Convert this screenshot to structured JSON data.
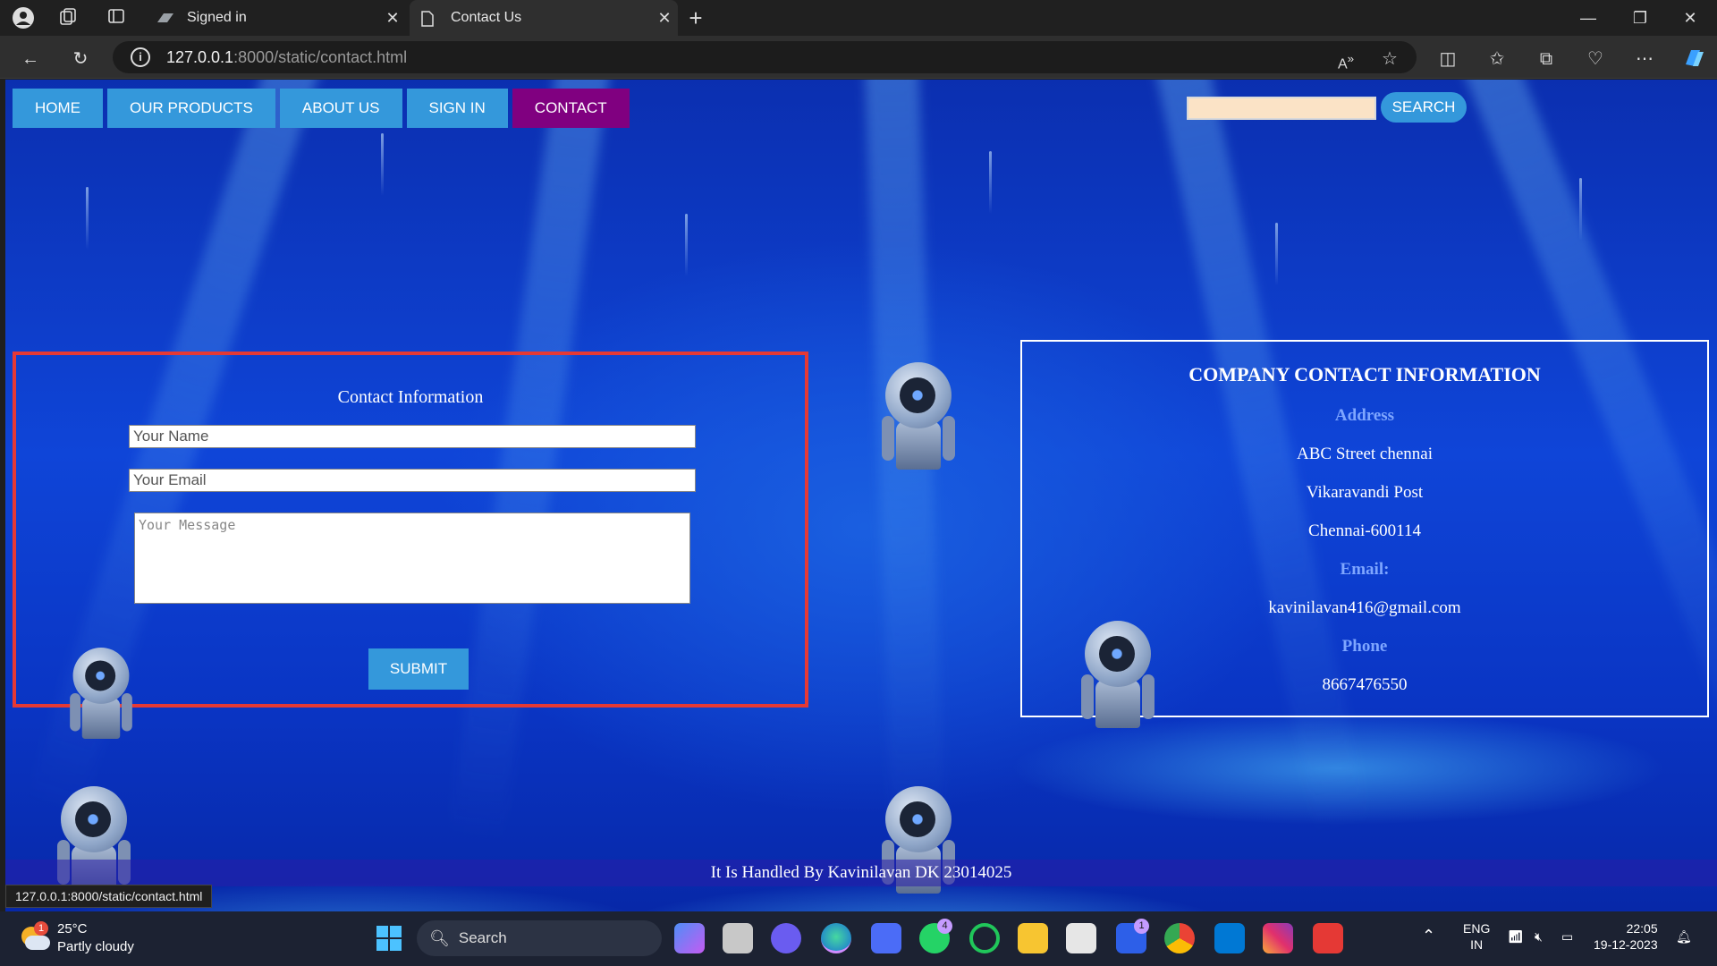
{
  "browser": {
    "tabs": [
      {
        "title": "Signed in",
        "active": false
      },
      {
        "title": "Contact Us",
        "active": true
      }
    ],
    "url_host": "127.0.0.1",
    "url_rest": ":8000/static/contact.html",
    "status_url": "127.0.0.1:8000/static/contact.html"
  },
  "nav": {
    "items": [
      "HOME",
      "OUR PRODUCTS",
      "ABOUT US",
      "SIGN IN",
      "CONTACT"
    ],
    "active": "CONTACT",
    "search_placeholder": "",
    "search_button": "SEARCH"
  },
  "contact_form": {
    "title": "Contact Information",
    "name_placeholder": "Your Name",
    "email_placeholder": "Your Email",
    "message_placeholder": "Your Message",
    "submit_label": "SUBMIT"
  },
  "company_info": {
    "heading": "COMPANY CONTACT INFORMATION",
    "address_label": "Address",
    "address_lines": [
      "ABC Street chennai",
      "Vikaravandi Post",
      "Chennai-600114"
    ],
    "email_label": "Email:",
    "email": "kavinilavan416@gmail.com",
    "phone_label": "Phone",
    "phone": "8667476550"
  },
  "footer": {
    "text": "It Is Handled By Kavinilavan DK 23014025"
  },
  "taskbar": {
    "weather_temp": "25°C",
    "weather_desc": "Partly cloudy",
    "weather_badge": "1",
    "search_label": "Search",
    "whatsapp_badge": "4",
    "l_app_badge": "1",
    "lang_top": "ENG",
    "lang_bottom": "IN",
    "time": "22:05",
    "date": "19-12-2023"
  },
  "colors": {
    "nav_button": "#3498db",
    "nav_active": "#800080",
    "form_border": "#e53935"
  }
}
